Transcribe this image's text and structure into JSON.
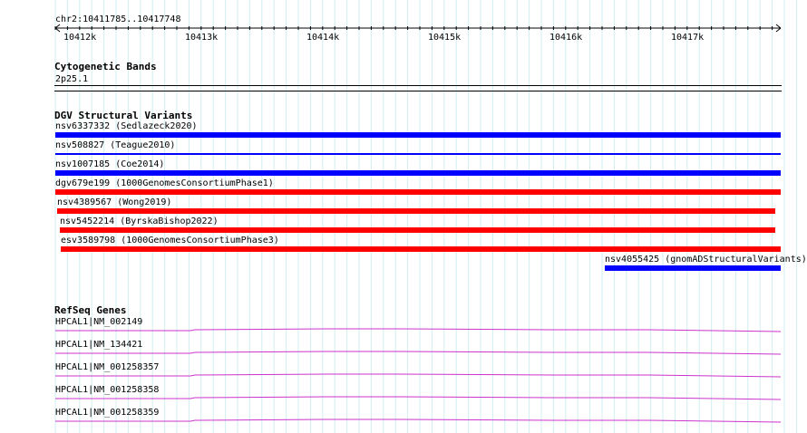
{
  "ruler": {
    "region": "chr2:10411785..10417748",
    "ticks": [
      "10412k",
      "10413k",
      "10414k",
      "10415k",
      "10416k",
      "10417k"
    ]
  },
  "cytoband": {
    "title": "Cytogenetic Bands",
    "band": "2p25.1"
  },
  "dgv": {
    "title": "DGV Structural Variants",
    "colors": {
      "gain": "#0000ff",
      "loss": "#ff0000"
    },
    "features": [
      {
        "label": "nsv6337332 (Sedlazeck2020)",
        "type": "gain",
        "start": 10411785,
        "end": 10417748
      },
      {
        "label": "nsv508827 (Teague2010)",
        "type": "gain-thin",
        "start": 10411785,
        "end": 10417748
      },
      {
        "label": "nsv1007185 (Coe2014)",
        "type": "gain",
        "start": 10411785,
        "end": 10417748
      },
      {
        "label": "dgv679e199 (1000GenomesConsortiumPhase1)",
        "type": "loss",
        "start": 10411785,
        "end": 10417748
      },
      {
        "label": "nsv4389567 (Wong2019)",
        "type": "loss",
        "start": 10411800,
        "end": 10417700
      },
      {
        "label": "nsv5452214 (ByrskaBishop2022)",
        "type": "loss",
        "start": 10411820,
        "end": 10417700
      },
      {
        "label": "esv3589798 (1000GenomesConsortiumPhase3)",
        "type": "loss",
        "start": 10411830,
        "end": 10417748
      },
      {
        "label": "nsv4055425 (gnomADStructuralVariants)",
        "type": "gain",
        "start": 10416300,
        "end": 10417748
      }
    ]
  },
  "refseq": {
    "title": "RefSeq Genes",
    "color": "#cc33cc",
    "genes": [
      {
        "label": "HPCAL1|NM_002149"
      },
      {
        "label": "HPCAL1|NM_134421"
      },
      {
        "label": "HPCAL1|NM_001258357"
      },
      {
        "label": "HPCAL1|NM_001258358"
      },
      {
        "label": "HPCAL1|NM_001258359"
      }
    ]
  }
}
